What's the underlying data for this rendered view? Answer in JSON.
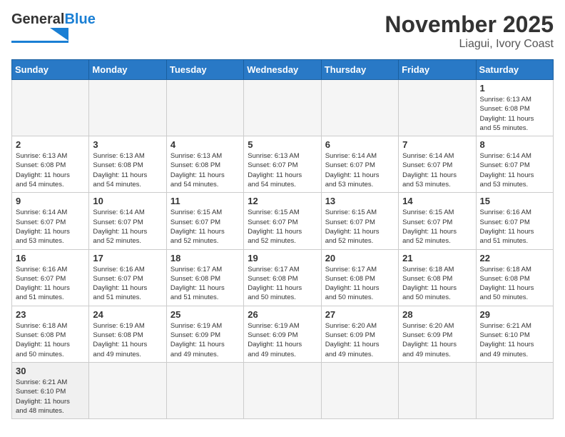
{
  "header": {
    "logo_text_general": "General",
    "logo_text_blue": "Blue",
    "title": "November 2025",
    "subtitle": "Liagui, Ivory Coast"
  },
  "calendar": {
    "days_of_week": [
      "Sunday",
      "Monday",
      "Tuesday",
      "Wednesday",
      "Thursday",
      "Friday",
      "Saturday"
    ],
    "weeks": [
      [
        {
          "day": "",
          "info": ""
        },
        {
          "day": "",
          "info": ""
        },
        {
          "day": "",
          "info": ""
        },
        {
          "day": "",
          "info": ""
        },
        {
          "day": "",
          "info": ""
        },
        {
          "day": "",
          "info": ""
        },
        {
          "day": "1",
          "info": "Sunrise: 6:13 AM\nSunset: 6:08 PM\nDaylight: 11 hours\nand 55 minutes."
        }
      ],
      [
        {
          "day": "2",
          "info": "Sunrise: 6:13 AM\nSunset: 6:08 PM\nDaylight: 11 hours\nand 54 minutes."
        },
        {
          "day": "3",
          "info": "Sunrise: 6:13 AM\nSunset: 6:08 PM\nDaylight: 11 hours\nand 54 minutes."
        },
        {
          "day": "4",
          "info": "Sunrise: 6:13 AM\nSunset: 6:08 PM\nDaylight: 11 hours\nand 54 minutes."
        },
        {
          "day": "5",
          "info": "Sunrise: 6:13 AM\nSunset: 6:07 PM\nDaylight: 11 hours\nand 54 minutes."
        },
        {
          "day": "6",
          "info": "Sunrise: 6:14 AM\nSunset: 6:07 PM\nDaylight: 11 hours\nand 53 minutes."
        },
        {
          "day": "7",
          "info": "Sunrise: 6:14 AM\nSunset: 6:07 PM\nDaylight: 11 hours\nand 53 minutes."
        },
        {
          "day": "8",
          "info": "Sunrise: 6:14 AM\nSunset: 6:07 PM\nDaylight: 11 hours\nand 53 minutes."
        }
      ],
      [
        {
          "day": "9",
          "info": "Sunrise: 6:14 AM\nSunset: 6:07 PM\nDaylight: 11 hours\nand 53 minutes."
        },
        {
          "day": "10",
          "info": "Sunrise: 6:14 AM\nSunset: 6:07 PM\nDaylight: 11 hours\nand 52 minutes."
        },
        {
          "day": "11",
          "info": "Sunrise: 6:15 AM\nSunset: 6:07 PM\nDaylight: 11 hours\nand 52 minutes."
        },
        {
          "day": "12",
          "info": "Sunrise: 6:15 AM\nSunset: 6:07 PM\nDaylight: 11 hours\nand 52 minutes."
        },
        {
          "day": "13",
          "info": "Sunrise: 6:15 AM\nSunset: 6:07 PM\nDaylight: 11 hours\nand 52 minutes."
        },
        {
          "day": "14",
          "info": "Sunrise: 6:15 AM\nSunset: 6:07 PM\nDaylight: 11 hours\nand 52 minutes."
        },
        {
          "day": "15",
          "info": "Sunrise: 6:16 AM\nSunset: 6:07 PM\nDaylight: 11 hours\nand 51 minutes."
        }
      ],
      [
        {
          "day": "16",
          "info": "Sunrise: 6:16 AM\nSunset: 6:07 PM\nDaylight: 11 hours\nand 51 minutes."
        },
        {
          "day": "17",
          "info": "Sunrise: 6:16 AM\nSunset: 6:07 PM\nDaylight: 11 hours\nand 51 minutes."
        },
        {
          "day": "18",
          "info": "Sunrise: 6:17 AM\nSunset: 6:08 PM\nDaylight: 11 hours\nand 51 minutes."
        },
        {
          "day": "19",
          "info": "Sunrise: 6:17 AM\nSunset: 6:08 PM\nDaylight: 11 hours\nand 50 minutes."
        },
        {
          "day": "20",
          "info": "Sunrise: 6:17 AM\nSunset: 6:08 PM\nDaylight: 11 hours\nand 50 minutes."
        },
        {
          "day": "21",
          "info": "Sunrise: 6:18 AM\nSunset: 6:08 PM\nDaylight: 11 hours\nand 50 minutes."
        },
        {
          "day": "22",
          "info": "Sunrise: 6:18 AM\nSunset: 6:08 PM\nDaylight: 11 hours\nand 50 minutes."
        }
      ],
      [
        {
          "day": "23",
          "info": "Sunrise: 6:18 AM\nSunset: 6:08 PM\nDaylight: 11 hours\nand 50 minutes."
        },
        {
          "day": "24",
          "info": "Sunrise: 6:19 AM\nSunset: 6:08 PM\nDaylight: 11 hours\nand 49 minutes."
        },
        {
          "day": "25",
          "info": "Sunrise: 6:19 AM\nSunset: 6:09 PM\nDaylight: 11 hours\nand 49 minutes."
        },
        {
          "day": "26",
          "info": "Sunrise: 6:19 AM\nSunset: 6:09 PM\nDaylight: 11 hours\nand 49 minutes."
        },
        {
          "day": "27",
          "info": "Sunrise: 6:20 AM\nSunset: 6:09 PM\nDaylight: 11 hours\nand 49 minutes."
        },
        {
          "day": "28",
          "info": "Sunrise: 6:20 AM\nSunset: 6:09 PM\nDaylight: 11 hours\nand 49 minutes."
        },
        {
          "day": "29",
          "info": "Sunrise: 6:21 AM\nSunset: 6:10 PM\nDaylight: 11 hours\nand 49 minutes."
        }
      ],
      [
        {
          "day": "30",
          "info": "Sunrise: 6:21 AM\nSunset: 6:10 PM\nDaylight: 11 hours\nand 48 minutes."
        },
        {
          "day": "",
          "info": ""
        },
        {
          "day": "",
          "info": ""
        },
        {
          "day": "",
          "info": ""
        },
        {
          "day": "",
          "info": ""
        },
        {
          "day": "",
          "info": ""
        },
        {
          "day": "",
          "info": ""
        }
      ]
    ]
  }
}
